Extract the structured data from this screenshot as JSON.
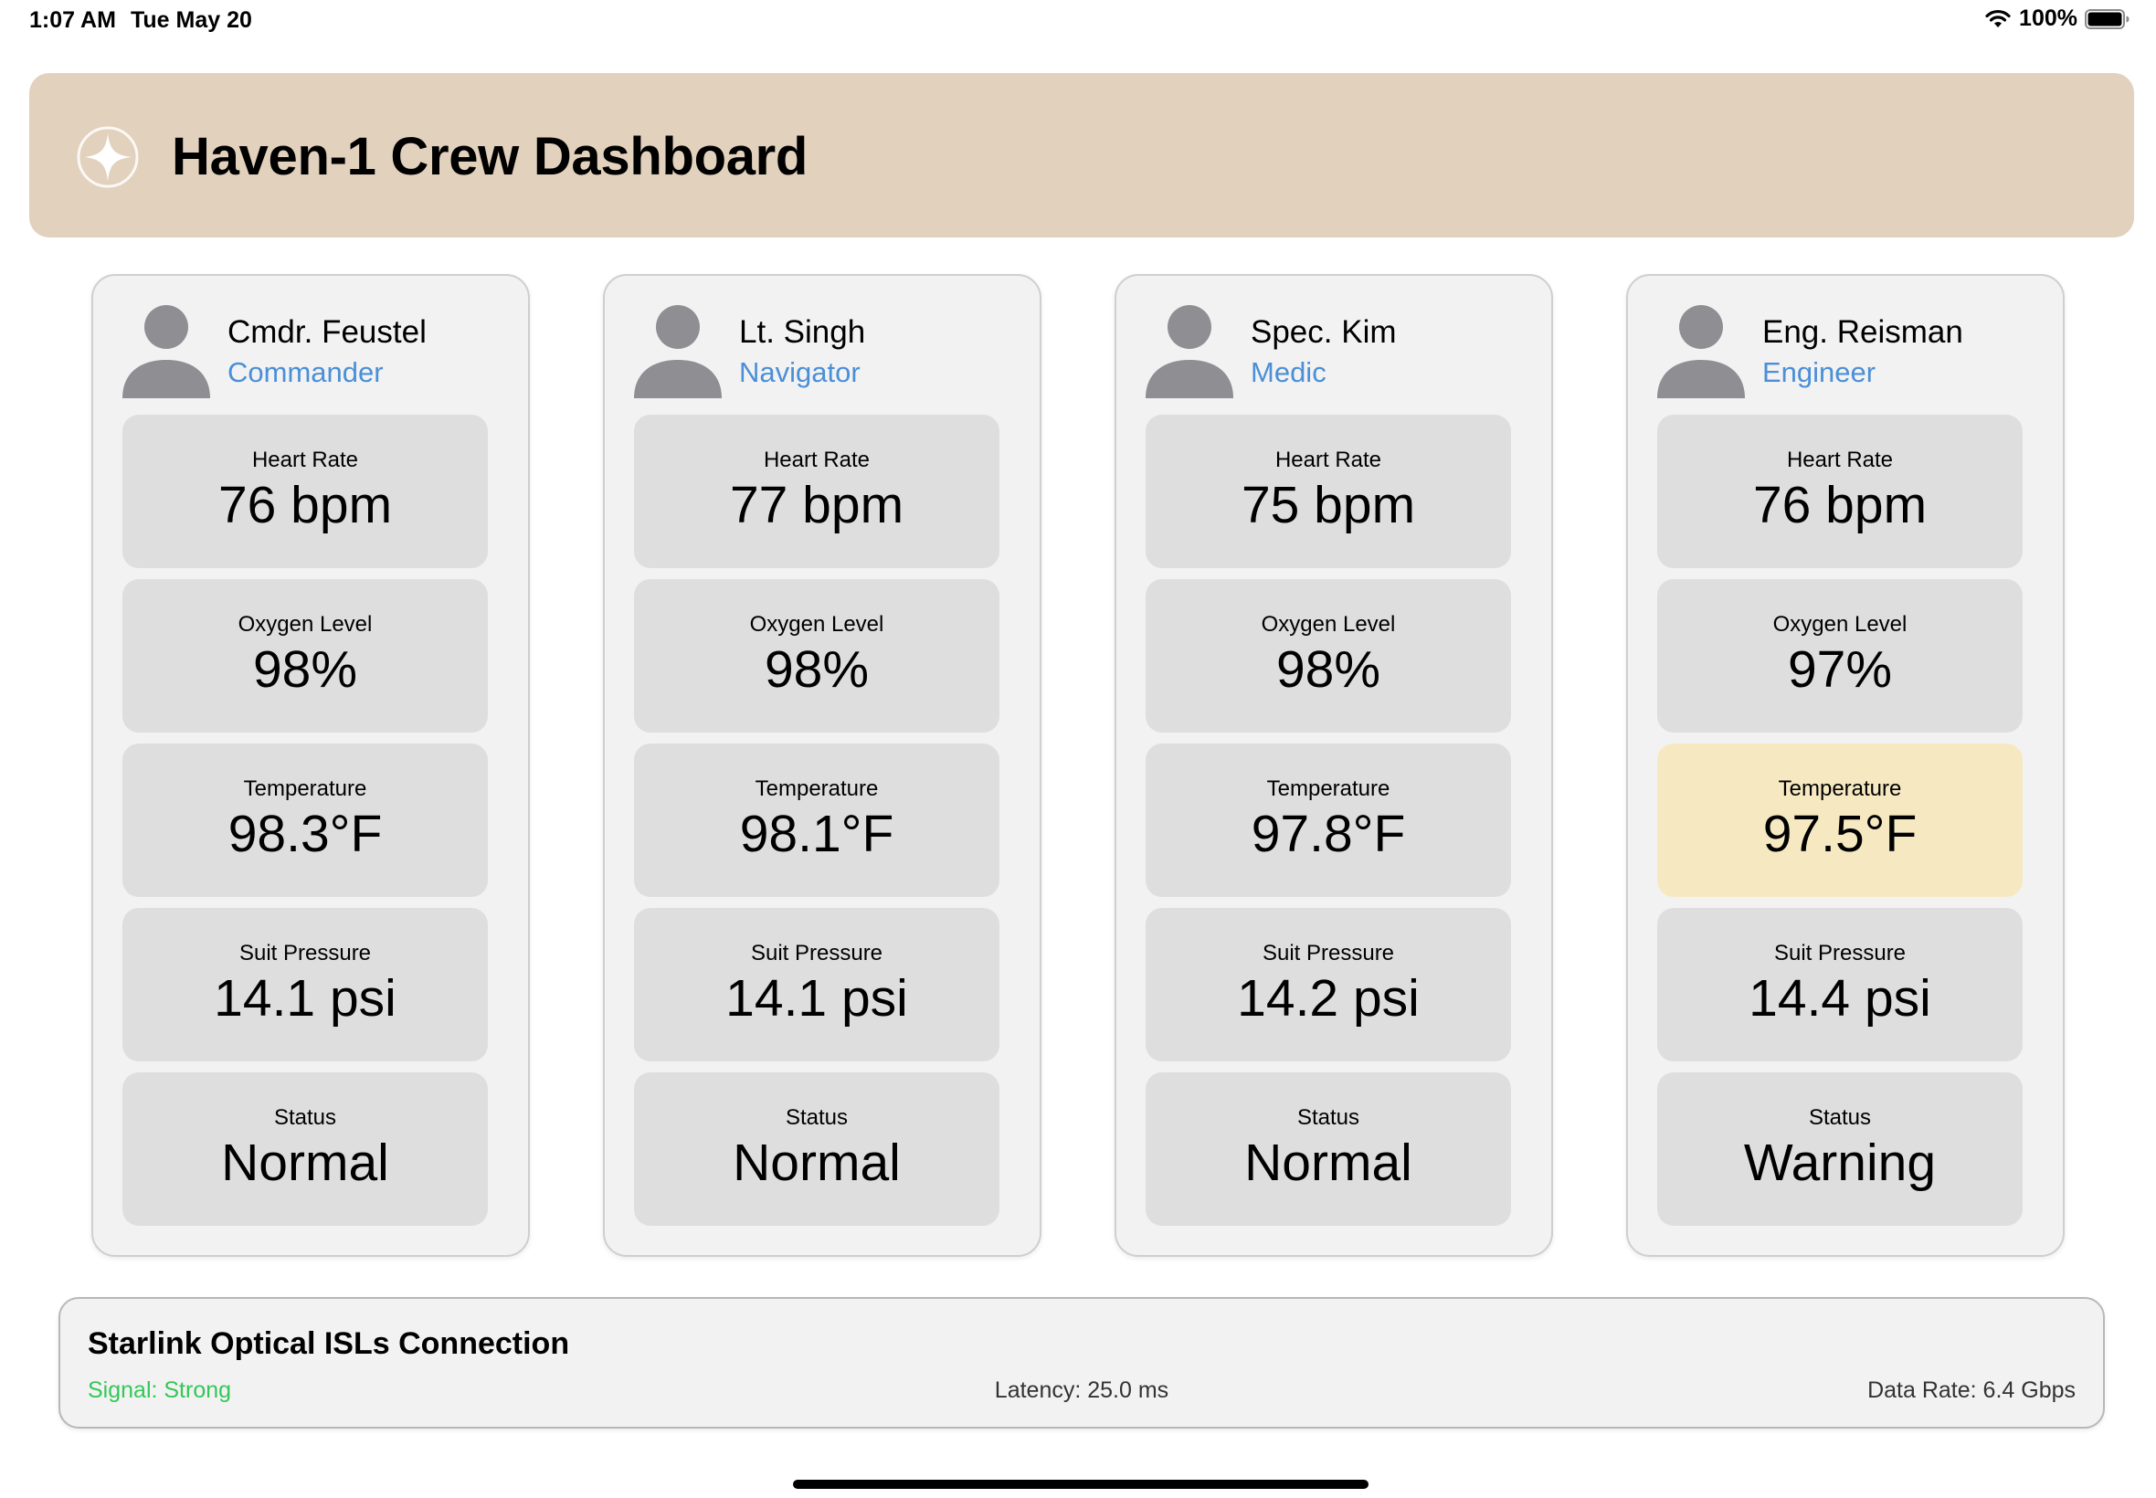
{
  "status_bar": {
    "time": "1:07 AM",
    "date": "Tue May 20",
    "battery": "100%",
    "battery_level": 1.0
  },
  "header": {
    "title": "Haven-1 Crew Dashboard",
    "background_color": "#e2d1bd",
    "logo_icon": "sparkle-icon"
  },
  "crew": [
    {
      "name": "Cmdr. Feustel",
      "role": "Commander",
      "metrics": [
        {
          "label": "Heart Rate",
          "value": "76 bpm"
        },
        {
          "label": "Oxygen Level",
          "value": "98%"
        },
        {
          "label": "Temperature",
          "value": "98.3°F"
        },
        {
          "label": "Suit Pressure",
          "value": "14.1 psi"
        },
        {
          "label": "Status",
          "value": "Normal"
        }
      ]
    },
    {
      "name": "Lt. Singh",
      "role": "Navigator",
      "metrics": [
        {
          "label": "Heart Rate",
          "value": "77 bpm"
        },
        {
          "label": "Oxygen Level",
          "value": "98%"
        },
        {
          "label": "Temperature",
          "value": "98.1°F"
        },
        {
          "label": "Suit Pressure",
          "value": "14.1 psi"
        },
        {
          "label": "Status",
          "value": "Normal"
        }
      ]
    },
    {
      "name": "Spec. Kim",
      "role": "Medic",
      "metrics": [
        {
          "label": "Heart Rate",
          "value": "75 bpm"
        },
        {
          "label": "Oxygen Level",
          "value": "98%"
        },
        {
          "label": "Temperature",
          "value": "97.8°F"
        },
        {
          "label": "Suit Pressure",
          "value": "14.2 psi"
        },
        {
          "label": "Status",
          "value": "Normal"
        }
      ]
    },
    {
      "name": "Eng. Reisman",
      "role": "Engineer",
      "metrics": [
        {
          "label": "Heart Rate",
          "value": "76 bpm"
        },
        {
          "label": "Oxygen Level",
          "value": "97%"
        },
        {
          "label": "Temperature",
          "value": "97.5°F",
          "highlight": "warning"
        },
        {
          "label": "Suit Pressure",
          "value": "14.4 psi"
        },
        {
          "label": "Status",
          "value": "Warning"
        }
      ]
    }
  ],
  "connection": {
    "title": "Starlink Optical ISLs Connection",
    "signal": "Signal: Strong",
    "latency": "Latency: 25.0 ms",
    "data_rate": "Data Rate: 6.4 Gbps",
    "signal_color": "#34c759"
  },
  "colors": {
    "role_text": "#4a8fd8",
    "metric_bg": "#dedede",
    "warning_bg": "#f6e9c2",
    "card_bg": "#f2f2f2"
  }
}
